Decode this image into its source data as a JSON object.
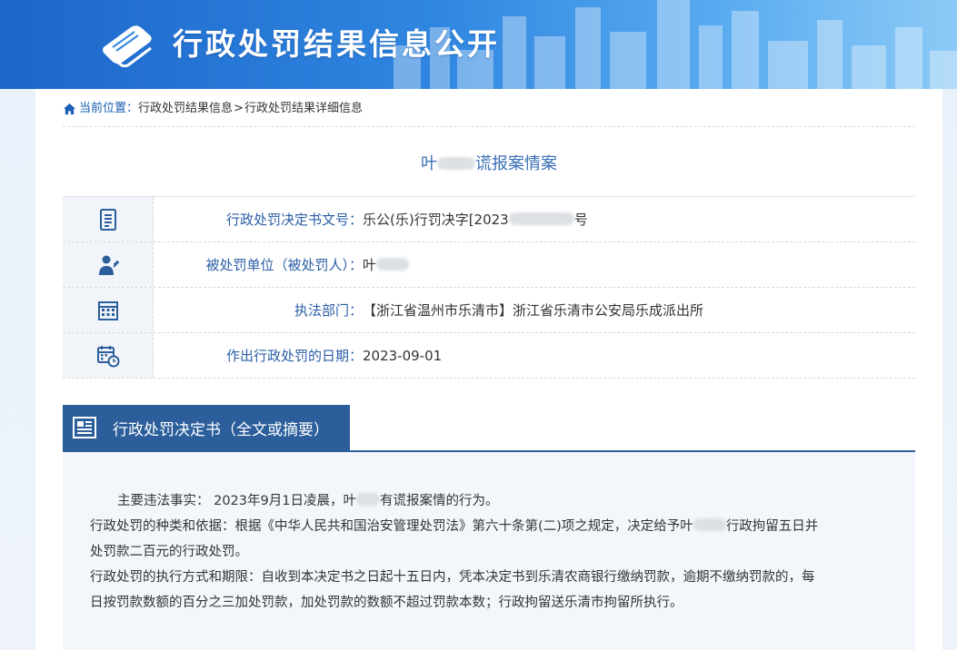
{
  "header": {
    "title": "行政处罚结果信息公开",
    "logo_icon": "book-icon"
  },
  "breadcrumb": {
    "current_label": "当前位置：",
    "level1": "行政处罚结果信息",
    "separator": ">",
    "level2": "行政处罚结果详细信息"
  },
  "case": {
    "title_prefix": "叶",
    "title_suffix": "谎报案情案"
  },
  "info_rows": [
    {
      "icon": "document-icon",
      "label": "行政处罚决定书文号：",
      "value": "乐公(乐)行罚决字[2023",
      "value_tail": "号"
    },
    {
      "icon": "person-icon",
      "label": "被处罚单位（被处罚人）：",
      "value": "叶"
    },
    {
      "icon": "building-icon",
      "label": "执法部门：",
      "value": "【浙江省温州市乐清市】浙江省乐清市公安局乐成派出所"
    },
    {
      "icon": "calendar-clock-icon",
      "label": "作出行政处罚的日期：",
      "value": "2023-09-01"
    }
  ],
  "decision": {
    "heading": "行政处罚决定书（全文或摘要）",
    "icon": "newspaper-icon",
    "para1_a": "主要违法事实： 2023年9月1日凌晨，叶",
    "para1_b": "有谎报案情的行为。",
    "para2_a": "行政处罚的种类和依据：根据《中华人民共和国治安管理处罚法》第六十条第(二)项之规定，决定给予叶",
    "para2_b": "行政拘留五日并",
    "para2_c": "处罚款二百元的行政处罚。",
    "para3_a": "行政处罚的执行方式和期限：自收到本决定书之日起十五日内，凭本决定书到乐清农商银行缴纳罚款，逾期不缴纳罚款的，每",
    "para3_b": "日按罚款数额的百分之三加处罚款，加处罚款的数额不超过罚款本数；行政拘留送乐清市拘留所执行。"
  },
  "colors": {
    "accent": "#2b5e9b",
    "label_blue": "#2a5ea6",
    "title_blue": "#3a6fb5"
  }
}
